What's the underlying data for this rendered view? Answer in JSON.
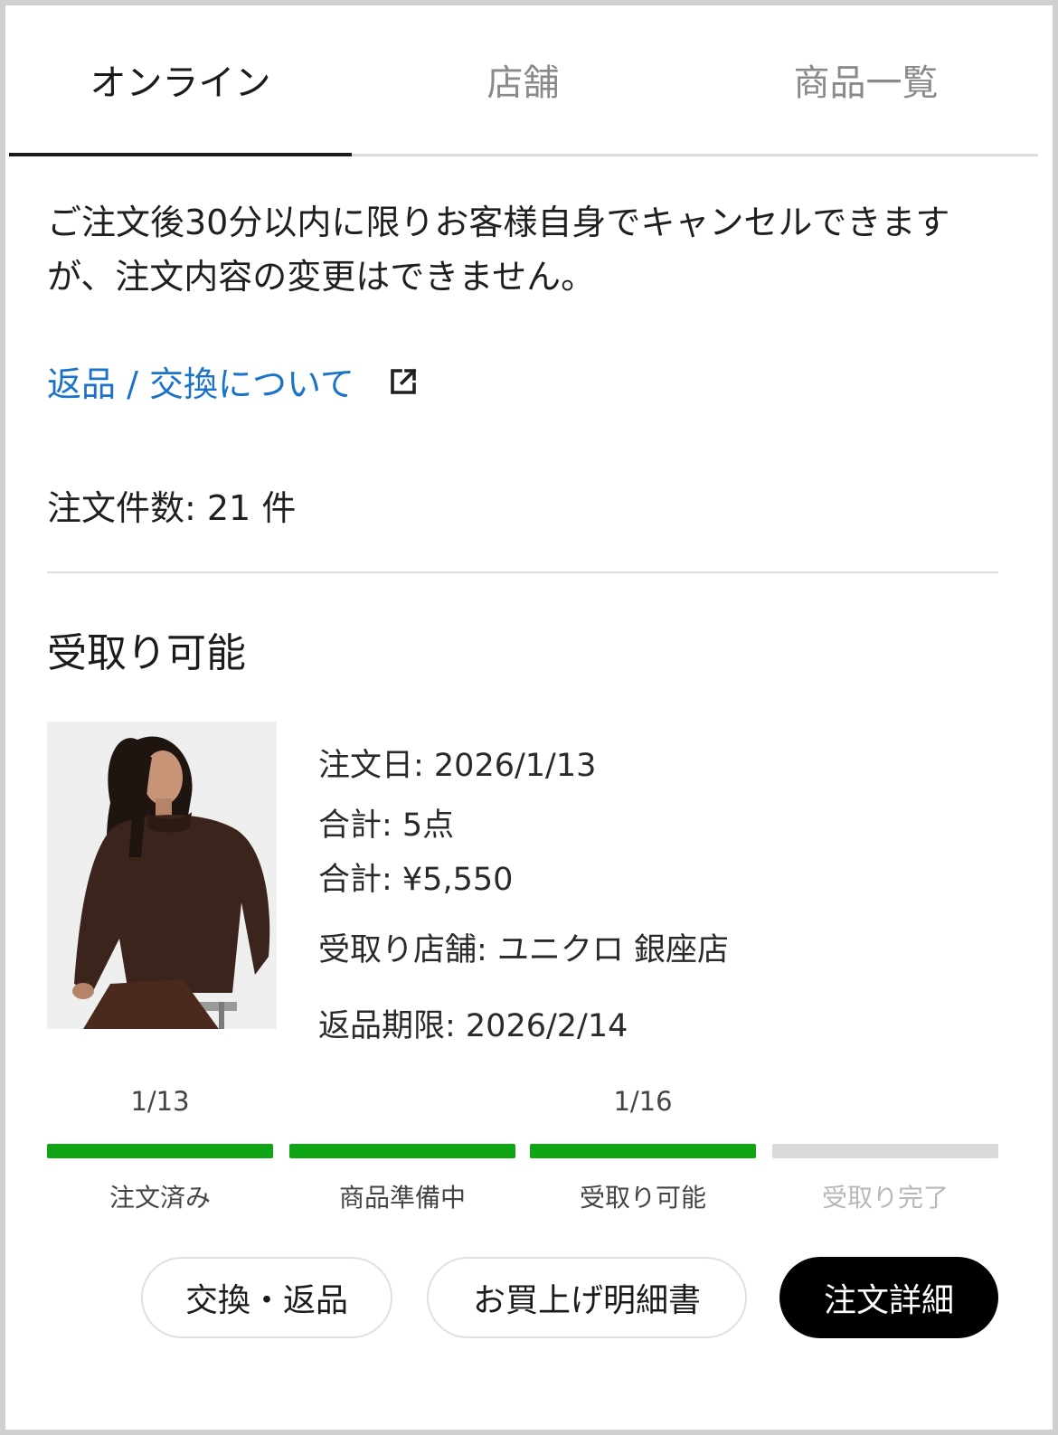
{
  "tabs": [
    {
      "label": "オンライン",
      "active": true
    },
    {
      "label": "店舗",
      "active": false
    },
    {
      "label": "商品一覧",
      "active": false
    }
  ],
  "notice": "ご注文後30分以内に限りお客様自身でキャンセルできますが、注文内容の変更はできません。",
  "return_link": {
    "label": "返品 / 交換について",
    "icon": "external-link-icon"
  },
  "order_count": "注文件数: 21 件",
  "section_title": "受取り可能",
  "order": {
    "date": "注文日: 2026/1/13",
    "quantity": "合計: 5点",
    "total": "合計: ¥5,550",
    "pickup_store": "受取り店舗: ユニクロ 銀座店",
    "return_deadline": "返品期限: 2026/2/14"
  },
  "progress": {
    "steps": [
      {
        "label": "注文済み",
        "date": "1/13",
        "done": true
      },
      {
        "label": "商品準備中",
        "date": "",
        "done": true
      },
      {
        "label": "受取り可能",
        "date": "1/16",
        "done": true
      },
      {
        "label": "受取り完了",
        "date": "",
        "done": false
      }
    ]
  },
  "buttons": {
    "exchange": "交換・返品",
    "receipt": "お買上げ明細書",
    "detail": "注文詳細"
  },
  "colors": {
    "link": "#1a73c8",
    "progress_done": "#10a514",
    "progress_todo": "#dadada",
    "primary_button": "#000000"
  }
}
